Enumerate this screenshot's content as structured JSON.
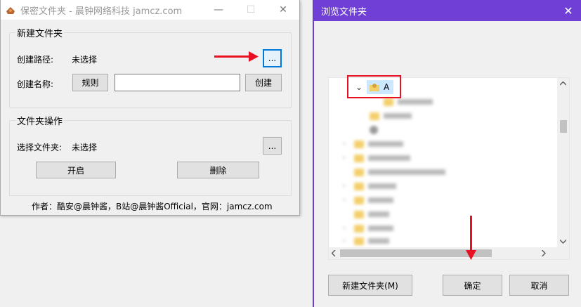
{
  "left_window": {
    "title": "保密文件夹 - 晨钟网络科技 jamcz.com",
    "minimize_glyph": "—",
    "maximize_glyph": "☐",
    "close_glyph": "✕",
    "new_folder_group": {
      "label": "新建文件夹",
      "path_label": "创建路径:",
      "path_value": "未选择",
      "browse_button": "...",
      "name_label": "创建名称:",
      "rule_button": "规则",
      "name_input_value": "",
      "create_button": "创建"
    },
    "folder_ops_group": {
      "label": "文件夹操作",
      "select_label": "选择文件夹:",
      "select_value": "未选择",
      "browse_button": "...",
      "open_button": "开启",
      "delete_button": "删除"
    },
    "footer": "作者：酷安@晨钟酱，B站@晨钟酱Official，官网：jamcz.com"
  },
  "right_window": {
    "title": "浏览文件夹",
    "close_glyph": "✕",
    "tree_root": {
      "expander": "⌄",
      "label": "A"
    },
    "new_folder_button": "新建文件夹(M)",
    "ok_button": "确定",
    "cancel_button": "取消"
  },
  "colors": {
    "accent": "#6f3fd6",
    "annotation_red": "#e81123",
    "focus_blue": "#0078d7",
    "folder_yellow": "#f3cf6a",
    "selected_bg": "#cce8ff"
  },
  "icons": [
    "app-icon",
    "folder-icon",
    "user-folder-icon",
    "expand-chevron-icon",
    "scroll-up-arrow-icon",
    "scroll-down-arrow-icon",
    "scroll-left-arrow-icon",
    "scroll-right-arrow-icon"
  ]
}
